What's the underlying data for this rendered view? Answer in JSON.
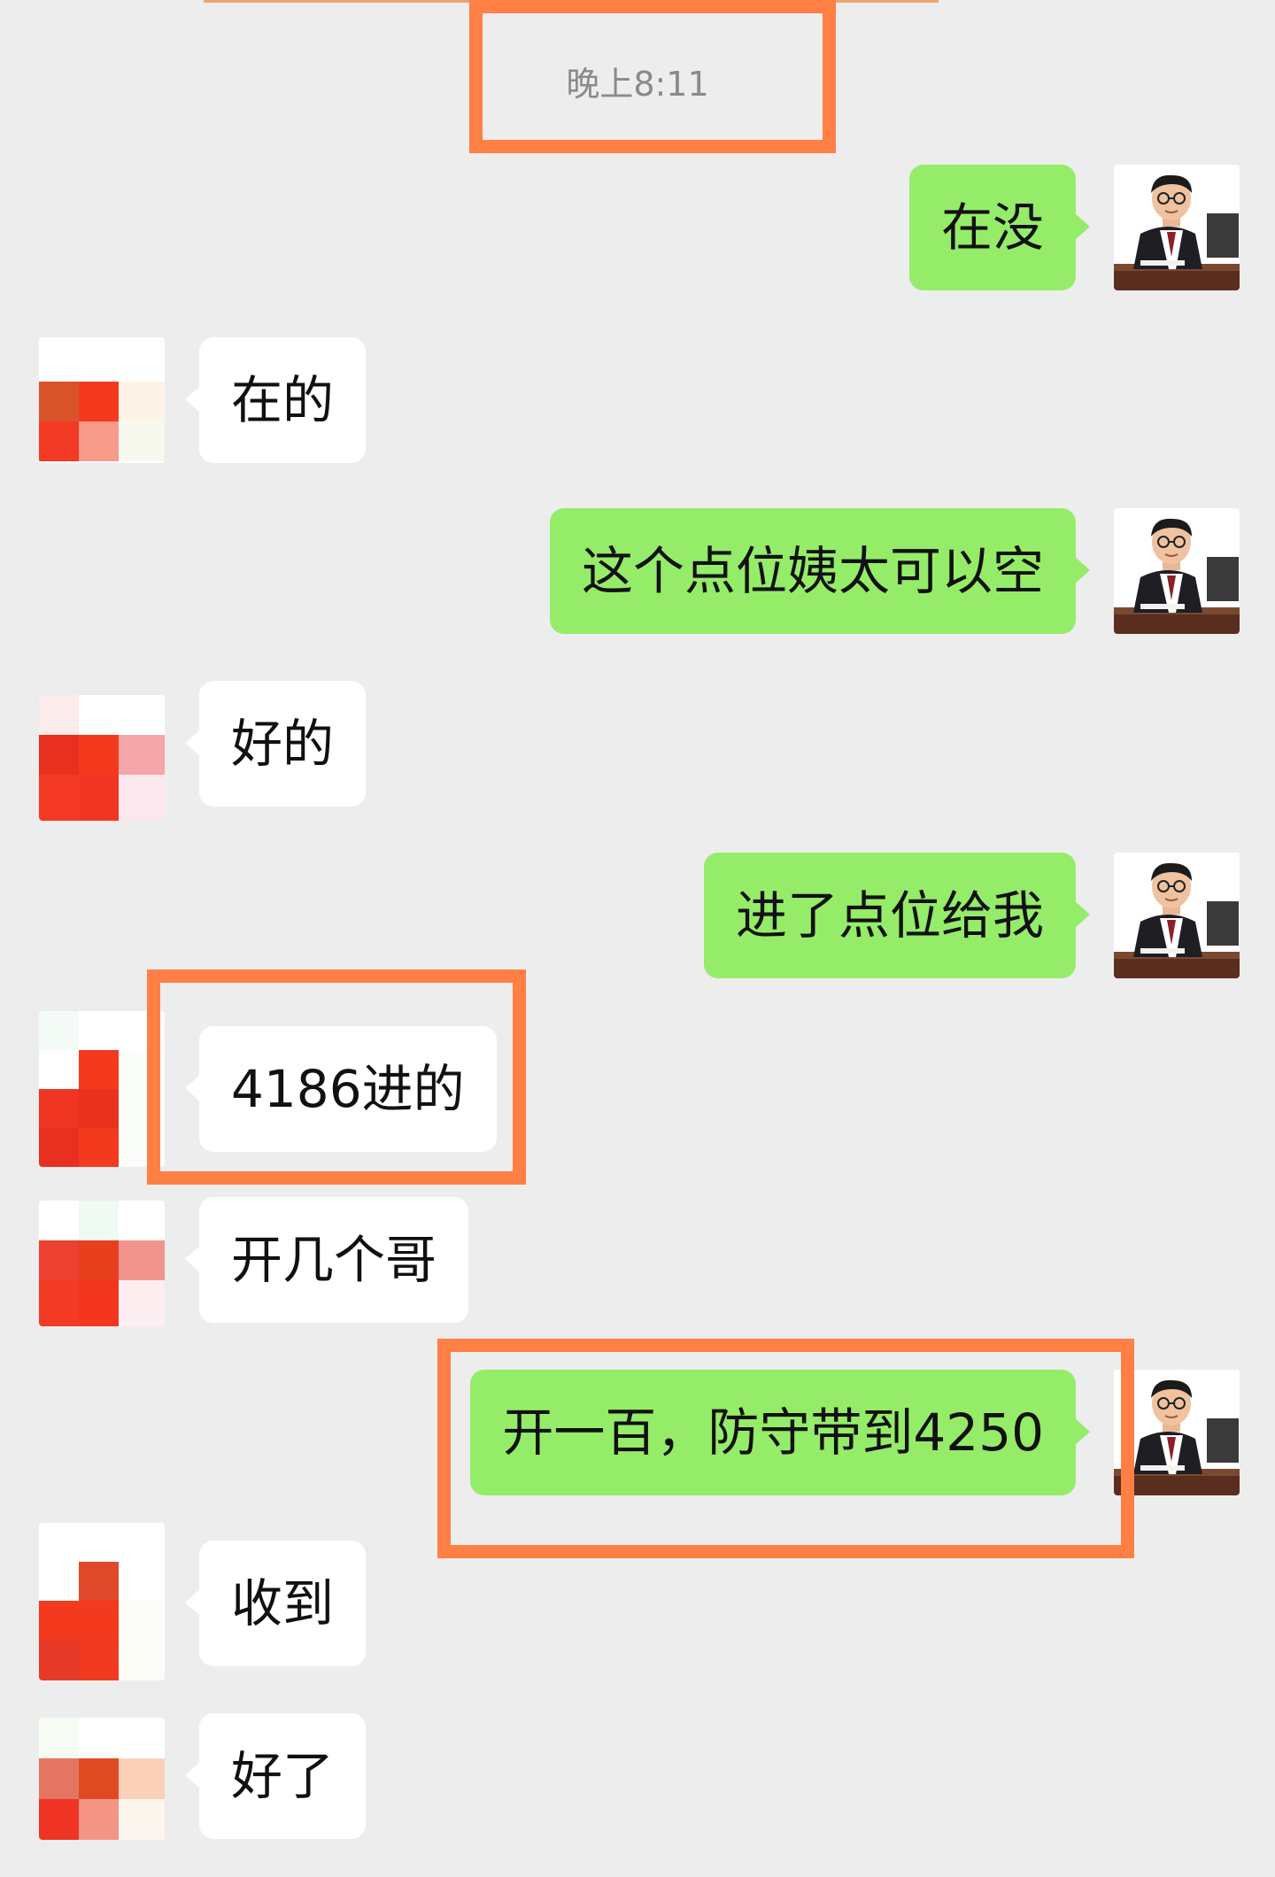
{
  "chat": {
    "timestamp": "晚上8:11",
    "messages": [
      {
        "sender": "self",
        "text": "在没"
      },
      {
        "sender": "other",
        "text": "在的"
      },
      {
        "sender": "self",
        "text": "这个点位姨太可以空"
      },
      {
        "sender": "other",
        "text": "好的"
      },
      {
        "sender": "self",
        "text": "进了点位给我"
      },
      {
        "sender": "other",
        "text": "4186进的"
      },
      {
        "sender": "other",
        "text": "开几个哥"
      },
      {
        "sender": "self",
        "text": "开一百，防守带到4250"
      },
      {
        "sender": "other",
        "text": "收到"
      },
      {
        "sender": "other",
        "text": "好了"
      }
    ]
  },
  "colors": {
    "background": "#ededed",
    "outgoing_bubble": "#95ec69",
    "incoming_bubble": "#ffffff",
    "highlight_box": "#ff7f45",
    "timestamp_text": "#8a8a8a"
  },
  "icons": {
    "self_avatar": "businessman-at-desk-avatar",
    "other_avatar": "pixelated-red-avatar"
  }
}
